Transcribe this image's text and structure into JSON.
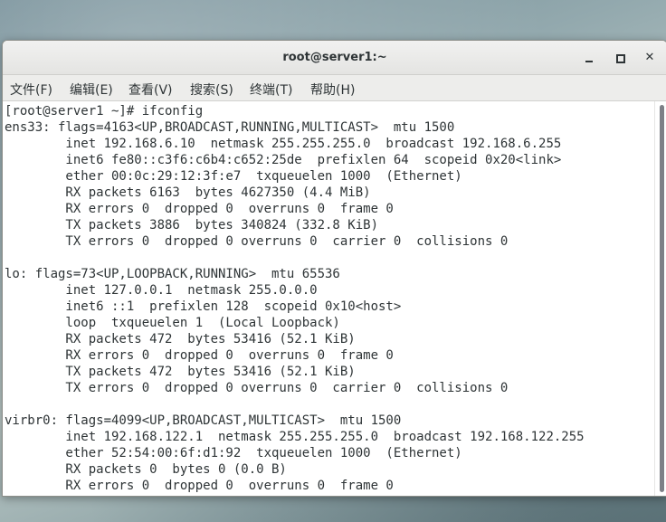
{
  "window": {
    "title": "root@server1:~",
    "minimize_icon": "minimize-icon",
    "maximize_icon": "maximize-icon",
    "close_label": "✕"
  },
  "menu": [
    {
      "label": "文件(F)"
    },
    {
      "label": "编辑(E)"
    },
    {
      "label": "查看(V)"
    },
    {
      "label": "搜索(S)"
    },
    {
      "label": "终端(T)"
    },
    {
      "label": "帮助(H)"
    }
  ],
  "terminal": {
    "lines": [
      "[root@server1 ~]# ifconfig",
      "ens33: flags=4163<UP,BROADCAST,RUNNING,MULTICAST>  mtu 1500",
      "        inet 192.168.6.10  netmask 255.255.255.0  broadcast 192.168.6.255",
      "        inet6 fe80::c3f6:c6b4:c652:25de  prefixlen 64  scopeid 0x20<link>",
      "        ether 00:0c:29:12:3f:e7  txqueuelen 1000  (Ethernet)",
      "        RX packets 6163  bytes 4627350 (4.4 MiB)",
      "        RX errors 0  dropped 0  overruns 0  frame 0",
      "        TX packets 3886  bytes 340824 (332.8 KiB)",
      "        TX errors 0  dropped 0 overruns 0  carrier 0  collisions 0",
      "",
      "lo: flags=73<UP,LOOPBACK,RUNNING>  mtu 65536",
      "        inet 127.0.0.1  netmask 255.0.0.0",
      "        inet6 ::1  prefixlen 128  scopeid 0x10<host>",
      "        loop  txqueuelen 1  (Local Loopback)",
      "        RX packets 472  bytes 53416 (52.1 KiB)",
      "        RX errors 0  dropped 0  overruns 0  frame 0",
      "        TX packets 472  bytes 53416 (52.1 KiB)",
      "        TX errors 0  dropped 0 overruns 0  carrier 0  collisions 0",
      "",
      "virbr0: flags=4099<UP,BROADCAST,MULTICAST>  mtu 1500",
      "        inet 192.168.122.1  netmask 255.255.255.0  broadcast 192.168.122.255",
      "        ether 52:54:00:6f:d1:92  txqueuelen 1000  (Ethernet)",
      "        RX packets 0  bytes 0 (0.0 B)",
      "        RX errors 0  dropped 0  overruns 0  frame 0"
    ]
  }
}
